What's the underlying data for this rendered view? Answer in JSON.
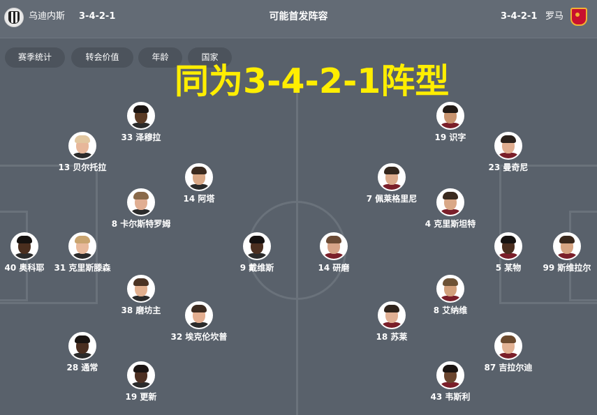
{
  "header": {
    "home_team": "乌迪内斯",
    "home_formation": "3-4-2-1",
    "title": "可能首发阵容",
    "away_formation": "3-4-2-1",
    "away_team": "罗马",
    "home_logo_icon": "udinese-crest-icon",
    "away_logo_icon": "roma-crest-icon"
  },
  "tabs": [
    {
      "label": "赛季统计"
    },
    {
      "label": "转会价值"
    },
    {
      "label": "年龄"
    },
    {
      "label": "国家"
    }
  ],
  "overlay_caption": "同为3-4-2-1阵型",
  "colors": {
    "background": "#59616b",
    "header": "#636b75",
    "tab": "#4c535c",
    "pitch_line": "#6a727b",
    "caption": "#ffee00"
  },
  "home_players": [
    {
      "number": "33",
      "name": "泽穆拉",
      "label": "33 泽穆拉",
      "skin": "#5a3a24",
      "hair": "#1a1411"
    },
    {
      "number": "13",
      "name": "贝尔托拉",
      "label": "13 贝尔托拉",
      "skin": "#e7b79a",
      "hair": "#e2c7a0"
    },
    {
      "number": "14",
      "name": "阿塔",
      "label": "14 阿塔",
      "skin": "#d9a886",
      "hair": "#3b2a1e"
    },
    {
      "number": "8",
      "name": "卡尔斯特罗姆",
      "label": "8 卡尔斯特罗姆",
      "skin": "#e0ae92",
      "hair": "#8a6a4a"
    },
    {
      "number": "40",
      "name": "奥科耶",
      "label": "40 奥科耶",
      "skin": "#4a2e1e",
      "hair": "#161210"
    },
    {
      "number": "31",
      "name": "克里斯滕森",
      "label": "31 克里斯滕森",
      "skin": "#e8b99b",
      "hair": "#c9a46f"
    },
    {
      "number": "9",
      "name": "戴维斯",
      "label": "9 戴维斯",
      "skin": "#4b2f20",
      "hair": "#151110"
    },
    {
      "number": "38",
      "name": "磨坊主",
      "label": "38 磨坊主",
      "skin": "#e2b08f",
      "hair": "#4b3323"
    },
    {
      "number": "32",
      "name": "埃克伦坎普",
      "label": "32 埃克伦坎普",
      "skin": "#e3ae90",
      "hair": "#3c2b20"
    },
    {
      "number": "28",
      "name": "通常",
      "label": "28 通常",
      "skin": "#4a2e20",
      "hair": "#1a1411"
    },
    {
      "number": "19",
      "name": "更新",
      "label": "19 更新",
      "skin": "#4d3022",
      "hair": "#1b1412"
    }
  ],
  "away_players": [
    {
      "number": "19",
      "name": "识字",
      "label": "19 识字",
      "skin": "#c9946f",
      "hair": "#221a15"
    },
    {
      "number": "23",
      "name": "曼奇尼",
      "label": "23 曼奇尼",
      "skin": "#e0ad8f",
      "hair": "#2b211b"
    },
    {
      "number": "7",
      "name": "佩莱格里尼",
      "label": "7 佩莱格里尼",
      "skin": "#dcab8c",
      "hair": "#33261c"
    },
    {
      "number": "4",
      "name": "克里斯坦特",
      "label": "4 克里斯坦特",
      "skin": "#d9a887",
      "hair": "#3a2a1f"
    },
    {
      "number": "14",
      "name": "研磨",
      "label": "14 研磨",
      "skin": "#d7a488",
      "hair": "#6b4b35"
    },
    {
      "number": "5",
      "name": "某物",
      "label": "5 某物",
      "skin": "#4a2e1f",
      "hair": "#161210"
    },
    {
      "number": "99",
      "name": "斯维拉尔",
      "label": "99 斯维拉尔",
      "skin": "#d7a583",
      "hair": "#3a281c"
    },
    {
      "number": "8",
      "name": "艾纳维",
      "label": "8 艾纳维",
      "skin": "#d2a07b",
      "hair": "#6d5235"
    },
    {
      "number": "18",
      "name": "苏莱",
      "label": "18 苏莱",
      "skin": "#e1b094",
      "hair": "#2f231b"
    },
    {
      "number": "87",
      "name": "吉拉尔迪",
      "label": "87 吉拉尔迪",
      "skin": "#e2b294",
      "hair": "#6c4a2e"
    },
    {
      "number": "43",
      "name": "韦斯利",
      "label": "43 韦斯利",
      "skin": "#6b452e",
      "hair": "#1a1310"
    }
  ]
}
